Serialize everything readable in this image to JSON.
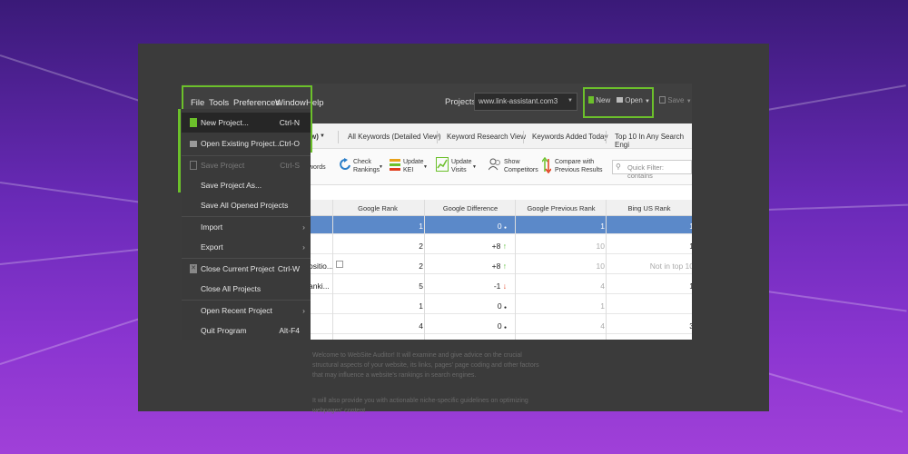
{
  "menubar": {
    "items": [
      {
        "label": "File"
      },
      {
        "label": "Tools"
      },
      {
        "label": "Preferences"
      },
      {
        "label": "Window"
      },
      {
        "label": "Help"
      }
    ],
    "projects_label": "Projects:",
    "projects_value": "www.link-assistant.com3",
    "new_label": "New",
    "open_label": "Open",
    "save_label": "Save"
  },
  "tabs": [
    {
      "label": "w)"
    },
    {
      "label": "All Keywords (Detailed View)"
    },
    {
      "label": "Keyword Research View"
    },
    {
      "label": "Keywords Added Today"
    },
    {
      "label": "Top 10 In Any Search Engi"
    }
  ],
  "toolbar": {
    "keywords_label": "words",
    "check_rankings": [
      "Check",
      "Rankings"
    ],
    "update_kei": [
      "Update",
      "KEI"
    ],
    "update_visits": [
      "Update",
      "Visits"
    ],
    "show_competitors": [
      "Show",
      "Competitors"
    ],
    "compare": [
      "Compare with",
      "Previous Results"
    ],
    "filter_placeholder": "Quick Filter: contains"
  },
  "table": {
    "headers": [
      "Google Rank",
      "Google Difference",
      "Google Previous Rank",
      "Bing US Rank"
    ],
    "rows": [
      {
        "kw": "",
        "rank": "1",
        "diff": "0",
        "dir": "none",
        "prev": "1",
        "bing": "1",
        "selected": true
      },
      {
        "kw": "",
        "rank": "2",
        "diff": "+8",
        "dir": "up",
        "prev": "10",
        "bing": "1",
        "selected": false
      },
      {
        "kw": "ositio...",
        "rank": "2",
        "diff": "+8",
        "dir": "up",
        "prev": "10",
        "bing": "Not in top 10",
        "selected": false
      },
      {
        "kw": "anki...",
        "rank": "5",
        "diff": "-1",
        "dir": "down",
        "prev": "4",
        "bing": "1",
        "selected": false
      },
      {
        "kw": "",
        "rank": "1",
        "diff": "0",
        "dir": "none",
        "prev": "1",
        "bing": "",
        "selected": false
      },
      {
        "kw": "",
        "rank": "4",
        "diff": "0",
        "dir": "none",
        "prev": "4",
        "bing": "3",
        "selected": false
      }
    ]
  },
  "file_menu": {
    "items": [
      {
        "label": "New Project...",
        "shortcut": "Ctrl-N",
        "state": "hover"
      },
      {
        "label": "Open Existing Project...",
        "shortcut": "Ctrl-O",
        "state": "normal"
      },
      {
        "label": "Save Project",
        "shortcut": "Ctrl-S",
        "state": "disabled"
      },
      {
        "label": "Save Project As...",
        "shortcut": "",
        "state": "normal"
      },
      {
        "label": "Save All Opened Projects",
        "shortcut": "",
        "state": "normal"
      },
      {
        "label": "Import",
        "shortcut": "",
        "state": "submenu"
      },
      {
        "label": "Export",
        "shortcut": "",
        "state": "submenu"
      },
      {
        "label": "Close Current Project",
        "shortcut": "Ctrl-W",
        "state": "normal"
      },
      {
        "label": "Close All Projects",
        "shortcut": "",
        "state": "normal"
      },
      {
        "label": "Open Recent Project",
        "shortcut": "",
        "state": "submenu"
      },
      {
        "label": "Quit Program",
        "shortcut": "Alt-F4",
        "state": "normal"
      }
    ]
  },
  "background": {
    "paragraph1": "Welcome to WebSite Auditor! It will examine and give advice on the crucial structural aspects of your website, its links, pages' page coding and other factors that may influence a website's rankings in search engines.",
    "paragraph2": "It will also provide you with actionable niche-specific guidelines on optimizing webpages' content"
  },
  "colors": {
    "accent_green": "#6cc02b",
    "selected_row": "#5b89c9",
    "menu_bg": "#3a3a3a"
  }
}
